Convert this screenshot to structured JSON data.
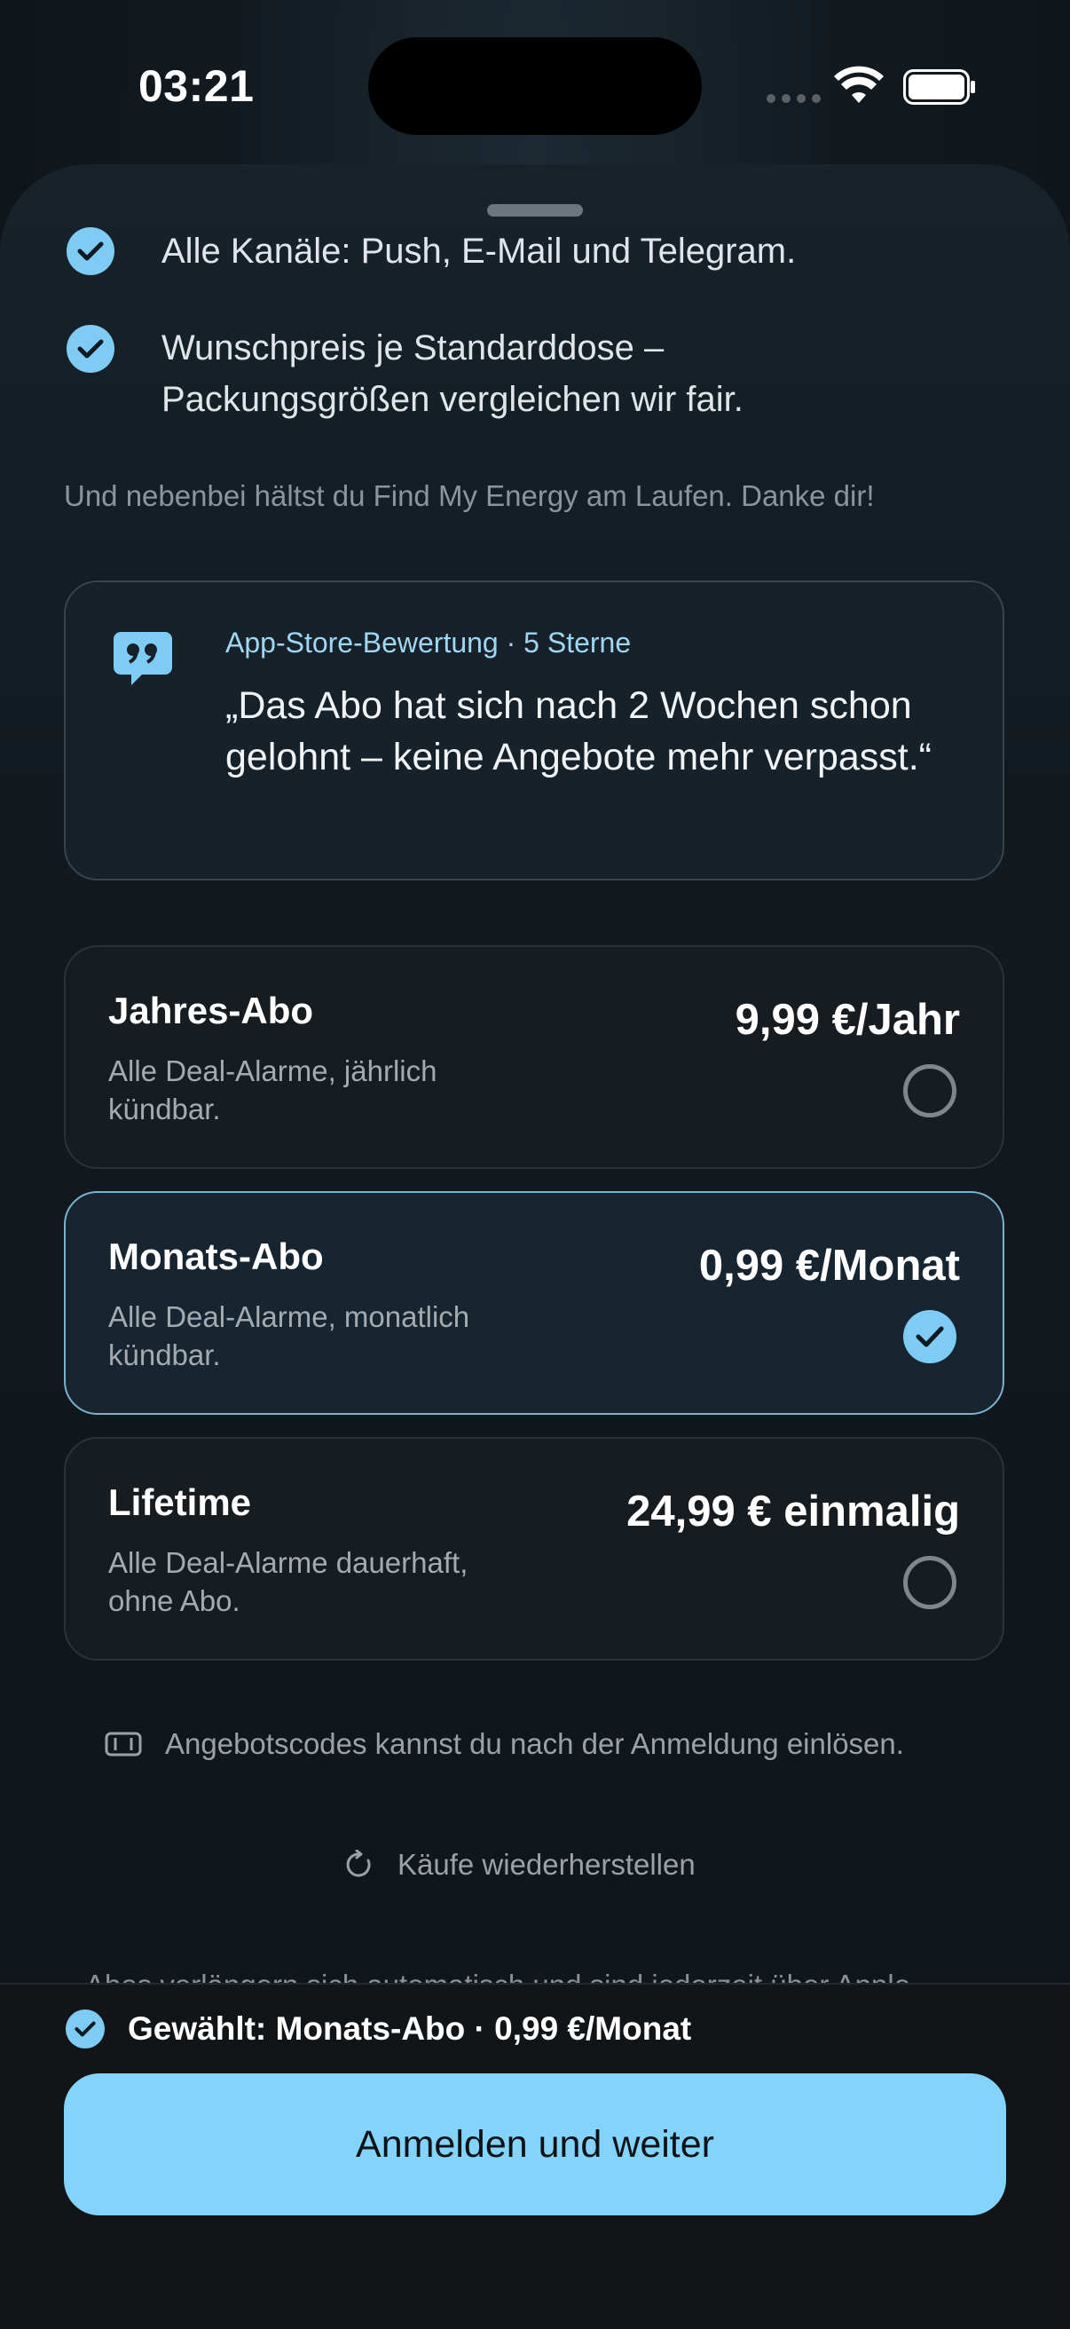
{
  "status_bar": {
    "time": "03:21"
  },
  "features": [
    {
      "text": "Alle Kanäle: Push, E-Mail und Telegram."
    },
    {
      "text": "Wunschpreis je Standarddose – Packungsgrößen vergleichen wir fair."
    }
  ],
  "note": "Und nebenbei hältst du Find My Energy am Laufen. Danke dir!",
  "review": {
    "source": "App-Store-Bewertung · 5 Sterne",
    "quote": "„Das Abo hat sich nach 2 Wochen schon gelohnt – keine Angebote mehr verpasst.“"
  },
  "plans": [
    {
      "name": "Jahres-Abo",
      "price": "9,99 €/Jahr",
      "description": "Alle Deal-Alarme, jährlich kündbar.",
      "selected": false
    },
    {
      "name": "Monats-Abo",
      "price": "0,99 €/Monat",
      "description": "Alle Deal-Alarme, monatlich kündbar.",
      "selected": true
    },
    {
      "name": "Lifetime",
      "price": "24,99 € einmalig",
      "description": "Alle Deal-Alarme dauerhaft, ohne Abo.",
      "selected": false
    }
  ],
  "offer_codes_text": "Angebotscodes kannst du nach der Anmeldung einlösen.",
  "restore_label": "Käufe wiederherstellen",
  "legal_text": "Abos verlängern sich automatisch und sind jederzeit über Apple",
  "footer": {
    "selected_summary": "Gewählt: Monats-Abo · 0,99 €/Monat",
    "cta_label": "Anmelden und weiter"
  },
  "colors": {
    "accent": "#7ecbf4",
    "cta": "#84d3fa",
    "background": "#0b1014"
  }
}
